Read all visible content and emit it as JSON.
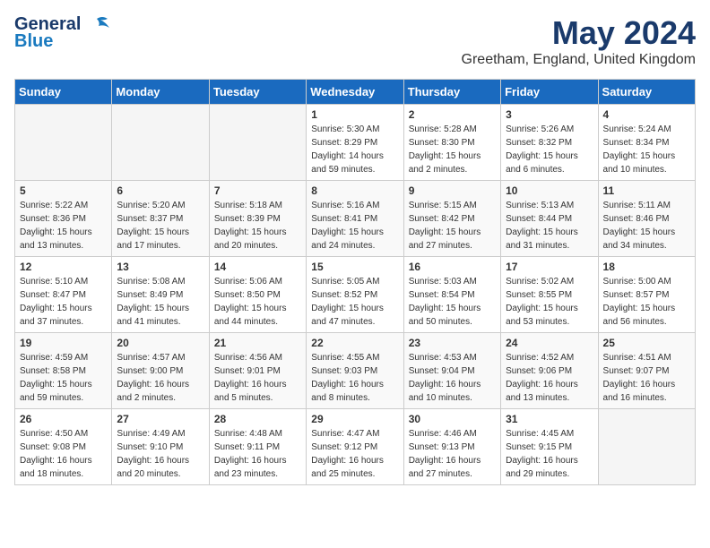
{
  "header": {
    "logo_line1": "General",
    "logo_line2": "Blue",
    "month": "May 2024",
    "location": "Greetham, England, United Kingdom"
  },
  "days_of_week": [
    "Sunday",
    "Monday",
    "Tuesday",
    "Wednesday",
    "Thursday",
    "Friday",
    "Saturday"
  ],
  "weeks": [
    [
      {
        "day": "",
        "info": ""
      },
      {
        "day": "",
        "info": ""
      },
      {
        "day": "",
        "info": ""
      },
      {
        "day": "1",
        "info": "Sunrise: 5:30 AM\nSunset: 8:29 PM\nDaylight: 14 hours\nand 59 minutes."
      },
      {
        "day": "2",
        "info": "Sunrise: 5:28 AM\nSunset: 8:30 PM\nDaylight: 15 hours\nand 2 minutes."
      },
      {
        "day": "3",
        "info": "Sunrise: 5:26 AM\nSunset: 8:32 PM\nDaylight: 15 hours\nand 6 minutes."
      },
      {
        "day": "4",
        "info": "Sunrise: 5:24 AM\nSunset: 8:34 PM\nDaylight: 15 hours\nand 10 minutes."
      }
    ],
    [
      {
        "day": "5",
        "info": "Sunrise: 5:22 AM\nSunset: 8:36 PM\nDaylight: 15 hours\nand 13 minutes."
      },
      {
        "day": "6",
        "info": "Sunrise: 5:20 AM\nSunset: 8:37 PM\nDaylight: 15 hours\nand 17 minutes."
      },
      {
        "day": "7",
        "info": "Sunrise: 5:18 AM\nSunset: 8:39 PM\nDaylight: 15 hours\nand 20 minutes."
      },
      {
        "day": "8",
        "info": "Sunrise: 5:16 AM\nSunset: 8:41 PM\nDaylight: 15 hours\nand 24 minutes."
      },
      {
        "day": "9",
        "info": "Sunrise: 5:15 AM\nSunset: 8:42 PM\nDaylight: 15 hours\nand 27 minutes."
      },
      {
        "day": "10",
        "info": "Sunrise: 5:13 AM\nSunset: 8:44 PM\nDaylight: 15 hours\nand 31 minutes."
      },
      {
        "day": "11",
        "info": "Sunrise: 5:11 AM\nSunset: 8:46 PM\nDaylight: 15 hours\nand 34 minutes."
      }
    ],
    [
      {
        "day": "12",
        "info": "Sunrise: 5:10 AM\nSunset: 8:47 PM\nDaylight: 15 hours\nand 37 minutes."
      },
      {
        "day": "13",
        "info": "Sunrise: 5:08 AM\nSunset: 8:49 PM\nDaylight: 15 hours\nand 41 minutes."
      },
      {
        "day": "14",
        "info": "Sunrise: 5:06 AM\nSunset: 8:50 PM\nDaylight: 15 hours\nand 44 minutes."
      },
      {
        "day": "15",
        "info": "Sunrise: 5:05 AM\nSunset: 8:52 PM\nDaylight: 15 hours\nand 47 minutes."
      },
      {
        "day": "16",
        "info": "Sunrise: 5:03 AM\nSunset: 8:54 PM\nDaylight: 15 hours\nand 50 minutes."
      },
      {
        "day": "17",
        "info": "Sunrise: 5:02 AM\nSunset: 8:55 PM\nDaylight: 15 hours\nand 53 minutes."
      },
      {
        "day": "18",
        "info": "Sunrise: 5:00 AM\nSunset: 8:57 PM\nDaylight: 15 hours\nand 56 minutes."
      }
    ],
    [
      {
        "day": "19",
        "info": "Sunrise: 4:59 AM\nSunset: 8:58 PM\nDaylight: 15 hours\nand 59 minutes."
      },
      {
        "day": "20",
        "info": "Sunrise: 4:57 AM\nSunset: 9:00 PM\nDaylight: 16 hours\nand 2 minutes."
      },
      {
        "day": "21",
        "info": "Sunrise: 4:56 AM\nSunset: 9:01 PM\nDaylight: 16 hours\nand 5 minutes."
      },
      {
        "day": "22",
        "info": "Sunrise: 4:55 AM\nSunset: 9:03 PM\nDaylight: 16 hours\nand 8 minutes."
      },
      {
        "day": "23",
        "info": "Sunrise: 4:53 AM\nSunset: 9:04 PM\nDaylight: 16 hours\nand 10 minutes."
      },
      {
        "day": "24",
        "info": "Sunrise: 4:52 AM\nSunset: 9:06 PM\nDaylight: 16 hours\nand 13 minutes."
      },
      {
        "day": "25",
        "info": "Sunrise: 4:51 AM\nSunset: 9:07 PM\nDaylight: 16 hours\nand 16 minutes."
      }
    ],
    [
      {
        "day": "26",
        "info": "Sunrise: 4:50 AM\nSunset: 9:08 PM\nDaylight: 16 hours\nand 18 minutes."
      },
      {
        "day": "27",
        "info": "Sunrise: 4:49 AM\nSunset: 9:10 PM\nDaylight: 16 hours\nand 20 minutes."
      },
      {
        "day": "28",
        "info": "Sunrise: 4:48 AM\nSunset: 9:11 PM\nDaylight: 16 hours\nand 23 minutes."
      },
      {
        "day": "29",
        "info": "Sunrise: 4:47 AM\nSunset: 9:12 PM\nDaylight: 16 hours\nand 25 minutes."
      },
      {
        "day": "30",
        "info": "Sunrise: 4:46 AM\nSunset: 9:13 PM\nDaylight: 16 hours\nand 27 minutes."
      },
      {
        "day": "31",
        "info": "Sunrise: 4:45 AM\nSunset: 9:15 PM\nDaylight: 16 hours\nand 29 minutes."
      },
      {
        "day": "",
        "info": ""
      }
    ]
  ]
}
